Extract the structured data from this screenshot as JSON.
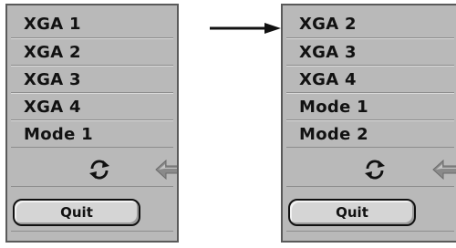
{
  "left_menu": {
    "items": [
      "XGA 1",
      "XGA 2",
      "XGA 3",
      "XGA 4",
      "Mode 1"
    ],
    "quit_label": "Quit"
  },
  "right_menu": {
    "items": [
      "XGA 2",
      "XGA 3",
      "XGA 4",
      "Mode 1",
      "Mode 2"
    ],
    "quit_label": "Quit"
  },
  "icons": {
    "refresh": "refresh-icon",
    "back": "back-arrow-icon",
    "transition": "right-arrow-icon"
  },
  "colors": {
    "panel_background": "#b9b9b9",
    "text": "#111111",
    "back_arrow": "#7f7f7f"
  }
}
